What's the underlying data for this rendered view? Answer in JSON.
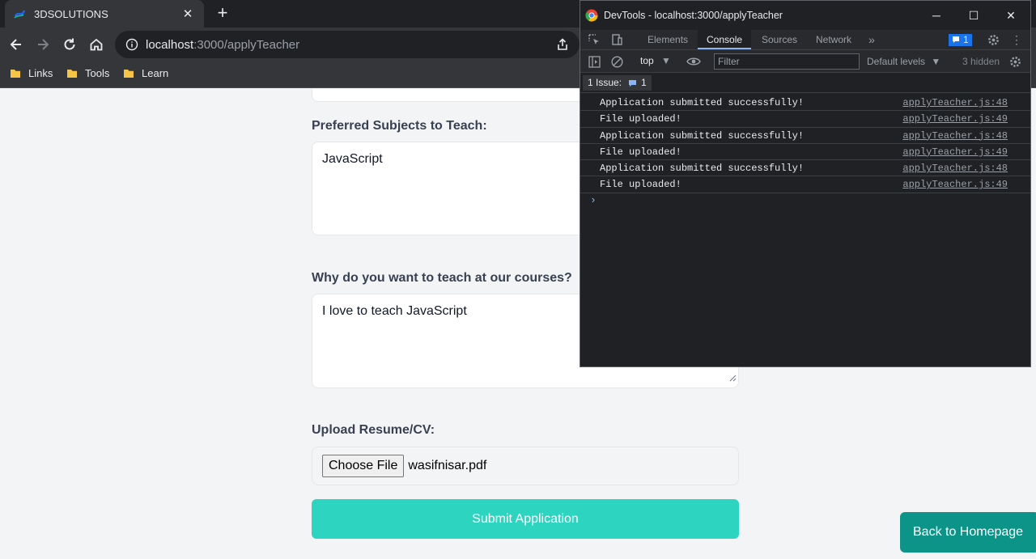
{
  "browser": {
    "tab_title": "3DSOLUTIONS",
    "url_host": "localhost",
    "url_rest": ":3000/applyTeacher",
    "bookmarks": [
      "Links",
      "Tools",
      "Learn"
    ]
  },
  "page": {
    "subjects_label": "Preferred Subjects to Teach:",
    "subjects_value": "JavaScript",
    "why_label": "Why do you want to teach at our courses?",
    "why_value": "I love to teach JavaScript",
    "upload_label": "Upload Resume/CV:",
    "choose_file_label": "Choose File",
    "file_name": "wasifnisar.pdf",
    "submit_label": "Submit Application",
    "back_label": "Back to Homepage"
  },
  "devtools": {
    "title": "DevTools - localhost:3000/applyTeacher",
    "tabs": [
      "Elements",
      "Console",
      "Sources",
      "Network"
    ],
    "active_tab": "Console",
    "issues_count_badge": "1",
    "context": "top",
    "filter_placeholder": "Filter",
    "levels": "Default levels",
    "hidden": "3 hidden",
    "issues_label": "1 Issue:",
    "issues_count": "1",
    "logs": [
      {
        "message": "Application submitted successfully!",
        "source": "applyTeacher.js:48"
      },
      {
        "message": "File uploaded!",
        "source": "applyTeacher.js:49"
      },
      {
        "message": "Application submitted successfully!",
        "source": "applyTeacher.js:48"
      },
      {
        "message": "File uploaded!",
        "source": "applyTeacher.js:49"
      },
      {
        "message": "Application submitted successfully!",
        "source": "applyTeacher.js:48"
      },
      {
        "message": "File uploaded!",
        "source": "applyTeacher.js:49"
      }
    ],
    "prompt": "›"
  },
  "colors": {
    "accent": "#2dd4bf",
    "back_button": "#0d9488",
    "page_bg": "#f3f4f6"
  }
}
